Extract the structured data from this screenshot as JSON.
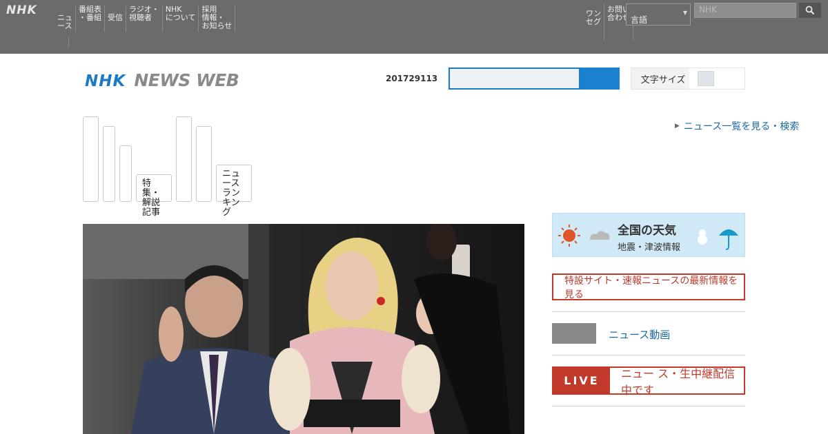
{
  "global_nav": {
    "logo": "NHK",
    "items": [
      {
        "label": "ニュ\nース"
      },
      {
        "label": "番組表\n・番組"
      },
      {
        "label": "受信"
      },
      {
        "label": "ラジオ・\n視聴者"
      },
      {
        "label": "NHK\nについて"
      },
      {
        "label": "採用\n情報・\nお知らせ"
      }
    ],
    "util_items": [
      {
        "label": "ワン\nセグ"
      },
      {
        "label": "お問い\n合わせ"
      }
    ],
    "language": "言語",
    "search_placeholder": "NHK"
  },
  "header": {
    "brand_nhk": "NHK",
    "brand_news": "NEWS WEB",
    "date": "201729113",
    "font_toggle_label": "文字サイズ"
  },
  "tabs": [
    {
      "label": ""
    },
    {
      "label": ""
    },
    {
      "label": ""
    },
    {
      "label": "特集・解説\n記事"
    },
    {
      "label": ""
    },
    {
      "label": ""
    },
    {
      "label": "ニュース\nランキング"
    }
  ],
  "more_link": "ニュース一覧を見る・検索",
  "weather": {
    "title": "全国の天気",
    "subtitle": "地震・津波情報"
  },
  "alert": "特設サイト・速報ニュースの最新情報を見る",
  "chip_label": "ニュース動画",
  "live": {
    "tag": "LIVE",
    "text": "ニュー ス・生中継配信中です"
  },
  "colors": {
    "brand_blue": "#1a7bc4",
    "alert_red": "#c0392b",
    "topbar": "#6b6b6b"
  }
}
